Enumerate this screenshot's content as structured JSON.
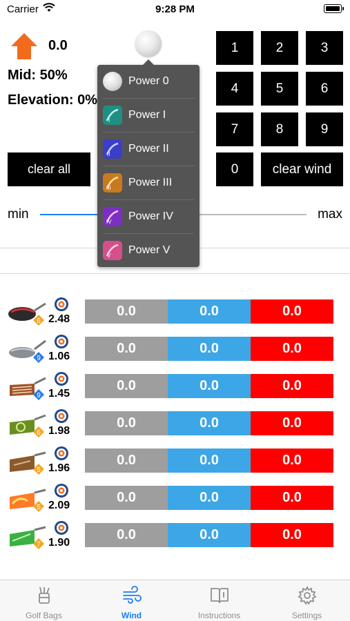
{
  "status_bar": {
    "carrier": "Carrier",
    "time": "9:28 PM"
  },
  "wind": {
    "value": "0.0",
    "mid": "Mid: 50%",
    "elevation": "Elevation: 0%",
    "arrow_color": "#f26b1d"
  },
  "keypad": {
    "keys": [
      "1",
      "2",
      "3",
      "4",
      "5",
      "6",
      "7",
      "8",
      "9",
      "0"
    ],
    "clear_wind": "clear wind"
  },
  "clear_all": "clear all",
  "slider": {
    "min_label": "min",
    "max_label": "max"
  },
  "power_menu": {
    "items": [
      {
        "label": "Power 0",
        "icon": "golf-ball-icon"
      },
      {
        "label": "Power I",
        "icon": "power-1-icon"
      },
      {
        "label": "Power II",
        "icon": "power-2-icon"
      },
      {
        "label": "Power III",
        "icon": "power-3-icon"
      },
      {
        "label": "Power IV",
        "icon": "power-4-icon"
      },
      {
        "label": "Power V",
        "icon": "power-5-icon"
      }
    ]
  },
  "clubs": [
    {
      "level": "6",
      "distance": "2.48",
      "gray": "0.0",
      "blue": "0.0",
      "red": "0.0",
      "icon": "driver-icon"
    },
    {
      "level": "9",
      "distance": "1.06",
      "gray": "0.0",
      "blue": "0.0",
      "red": "0.0",
      "icon": "wood-icon"
    },
    {
      "level": "9",
      "distance": "1.45",
      "gray": "0.0",
      "blue": "0.0",
      "red": "0.0",
      "icon": "long-iron-icon"
    },
    {
      "level": "6",
      "distance": "1.98",
      "gray": "0.0",
      "blue": "0.0",
      "red": "0.0",
      "icon": "short-iron-icon"
    },
    {
      "level": "5",
      "distance": "1.96",
      "gray": "0.0",
      "blue": "0.0",
      "red": "0.0",
      "icon": "wedge-icon"
    },
    {
      "level": "5",
      "distance": "2.09",
      "gray": "0.0",
      "blue": "0.0",
      "red": "0.0",
      "icon": "rough-iron-icon"
    },
    {
      "level": "7",
      "distance": "1.90",
      "gray": "0.0",
      "blue": "0.0",
      "red": "0.0",
      "icon": "sand-wedge-icon"
    }
  ],
  "colors": {
    "gray": "#9e9e9e",
    "blue": "#3da6e6",
    "red": "#ff0000",
    "accent": "#1a7cf5"
  },
  "tabs": [
    {
      "label": "Golf Bags",
      "icon": "golf-bag-icon",
      "active": false
    },
    {
      "label": "Wind",
      "icon": "wind-icon",
      "active": true
    },
    {
      "label": "Instructions",
      "icon": "book-icon",
      "active": false
    },
    {
      "label": "Settings",
      "icon": "gear-icon",
      "active": false
    }
  ]
}
